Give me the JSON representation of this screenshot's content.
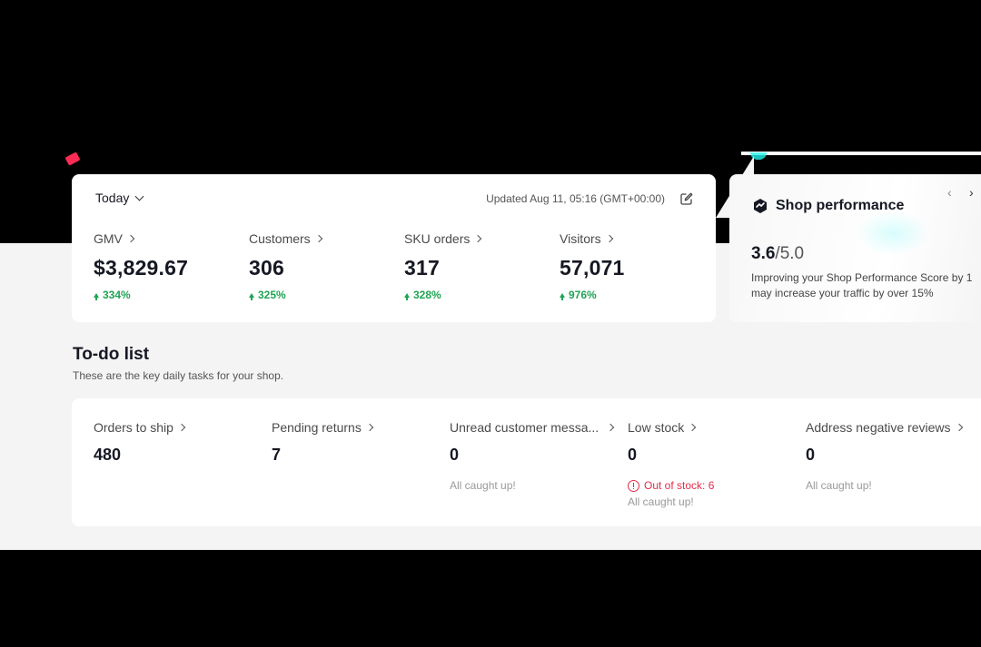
{
  "metrics": {
    "period": "Today",
    "updated": "Updated Aug 11, 05:16 (GMT+00:00)",
    "items": [
      {
        "label": "GMV",
        "value": "$3,829.67",
        "change": "334%"
      },
      {
        "label": "Customers",
        "value": "306",
        "change": "325%"
      },
      {
        "label": "SKU orders",
        "value": "317",
        "change": "328%"
      },
      {
        "label": "Visitors",
        "value": "57,071",
        "change": "976%"
      }
    ]
  },
  "performance": {
    "title": "Shop performance",
    "score": "3.6",
    "total": "/5.0",
    "description": "Improving your Shop Performance Score by 1 may increase your traffic by over 15%",
    "prev": "‹",
    "next": "›"
  },
  "todo": {
    "title": "To-do list",
    "subtitle": "These are the key daily tasks for your shop.",
    "items": [
      {
        "label": "Orders to ship",
        "value": "480"
      },
      {
        "label": "Pending returns",
        "value": "7"
      },
      {
        "label": "Unread customer messa...",
        "value": "0",
        "note": "All caught up!"
      },
      {
        "label": "Low stock",
        "value": "0",
        "alert": "Out of stock: 6",
        "note": "All caught up!"
      },
      {
        "label": "Address negative reviews",
        "value": "0",
        "note": "All caught up!"
      }
    ]
  },
  "colors": {
    "positive": "#1ea453",
    "alert": "#e22d4a",
    "brand_red": "#fe2c55",
    "brand_teal": "#25f4ee"
  }
}
